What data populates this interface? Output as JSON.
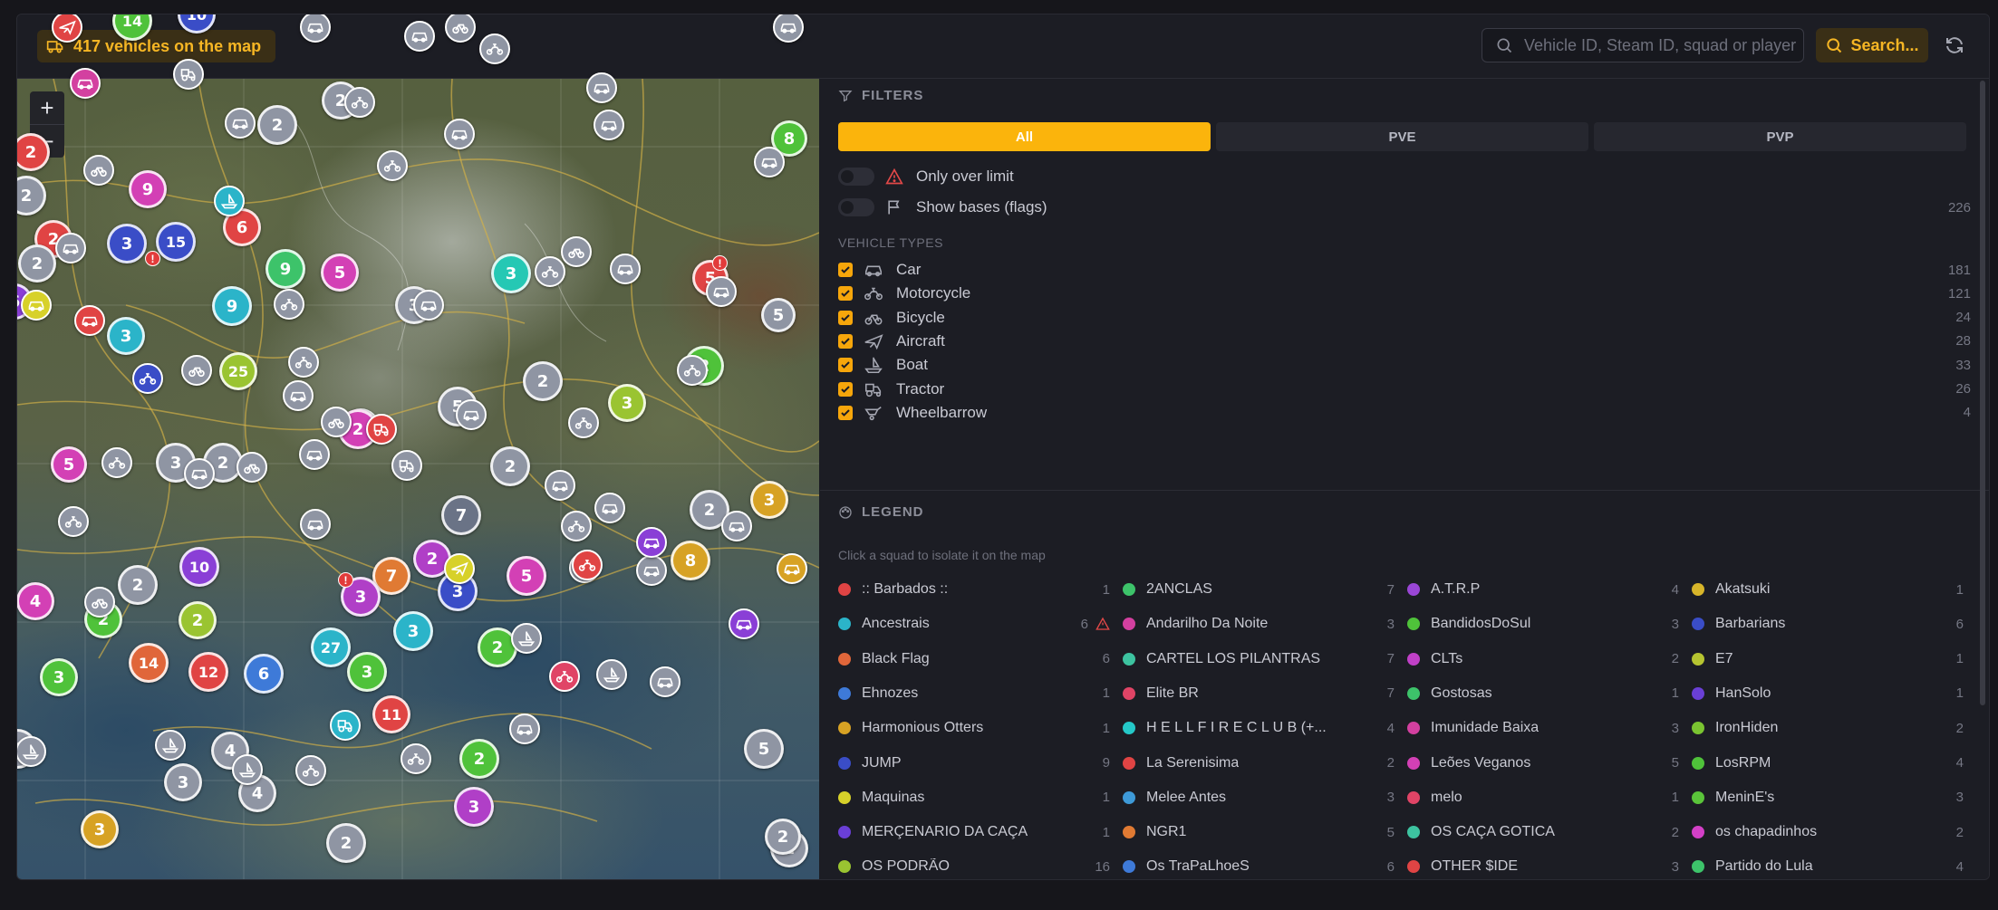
{
  "header": {
    "vehicle_count": "417 vehicles on the map",
    "search_placeholder": "Vehicle ID, Steam ID, squad or player",
    "search_button": "Search..."
  },
  "map": {
    "zoom_in": "+",
    "zoom_out": "−",
    "clusters": [
      {
        "n": "14",
        "c": "#4fc23a"
      },
      {
        "n": "10",
        "c": "#3a4dc7"
      },
      {
        "n": "2",
        "c": "#e04444"
      },
      {
        "n": "2",
        "c": "#8f95a3"
      },
      {
        "n": "2",
        "c": "#e04444"
      },
      {
        "n": "2",
        "c": "#8f95a3"
      },
      {
        "n": "9",
        "c": "#d340b5"
      },
      {
        "n": "3",
        "c": "#3a4dc7"
      },
      {
        "n": "15",
        "c": "#3a4dc7"
      },
      {
        "n": "6",
        "c": "#e04444"
      },
      {
        "n": "2",
        "c": "#8f95a3"
      },
      {
        "n": "2",
        "c": "#8f95a3"
      },
      {
        "n": "6",
        "c": "#8a3fd6"
      },
      {
        "n": "9",
        "c": "#3dc36a"
      },
      {
        "n": "5",
        "c": "#d340b5"
      },
      {
        "n": "9",
        "c": "#2bb4c9"
      },
      {
        "n": "3",
        "c": "#2bb4c9"
      },
      {
        "n": "25",
        "c": "#9ac431"
      },
      {
        "n": "3",
        "c": "#8f95a3"
      },
      {
        "n": "3",
        "c": "#25c8b4"
      },
      {
        "n": "5",
        "c": "#e04444"
      },
      {
        "n": "5",
        "c": "#8f95a3"
      },
      {
        "n": "2",
        "c": "#4fc23a"
      },
      {
        "n": "2",
        "c": "#8f95a3"
      },
      {
        "n": "3",
        "c": "#9ac431"
      },
      {
        "n": "5",
        "c": "#8f95a3"
      },
      {
        "n": "2",
        "c": "#8f95a3"
      },
      {
        "n": "2",
        "c": "#d340b5"
      },
      {
        "n": "2",
        "c": "#8f95a3"
      },
      {
        "n": "3",
        "c": "#8f95a3"
      },
      {
        "n": "5",
        "c": "#d340b5"
      },
      {
        "n": "2",
        "c": "#8f95a3"
      },
      {
        "n": "3",
        "c": "#d7a224"
      },
      {
        "n": "2",
        "c": "#8f95a3"
      },
      {
        "n": "7",
        "c": "#6a7386"
      },
      {
        "n": "10",
        "c": "#8a3fd6"
      },
      {
        "n": "2",
        "c": "#8f95a3"
      },
      {
        "n": "4",
        "c": "#d340b5"
      },
      {
        "n": "2",
        "c": "#4fc23a"
      },
      {
        "n": "2",
        "c": "#9ac431"
      },
      {
        "n": "7",
        "c": "#e07a33"
      },
      {
        "n": "2",
        "c": "#b03fc7"
      },
      {
        "n": "3",
        "c": "#b03fc7"
      },
      {
        "n": "3",
        "c": "#3a4dc7"
      },
      {
        "n": "5",
        "c": "#d340b5"
      },
      {
        "n": "8",
        "c": "#d7a224"
      },
      {
        "n": "14",
        "c": "#e0663a"
      },
      {
        "n": "12",
        "c": "#e04444"
      },
      {
        "n": "6",
        "c": "#3e7ad8"
      },
      {
        "n": "27",
        "c": "#2bb4c9"
      },
      {
        "n": "3",
        "c": "#4fc23a"
      },
      {
        "n": "3",
        "c": "#2bb4c9"
      },
      {
        "n": "2",
        "c": "#4fc23a"
      },
      {
        "n": "3",
        "c": "#4fc23a"
      },
      {
        "n": "11",
        "c": "#e04444"
      },
      {
        "n": "2",
        "c": "#8f95a3"
      },
      {
        "n": "4",
        "c": "#8f95a3"
      },
      {
        "n": "3",
        "c": "#8f95a3"
      },
      {
        "n": "4",
        "c": "#8f95a3"
      },
      {
        "n": "2",
        "c": "#4fc23a"
      },
      {
        "n": "3",
        "c": "#b03fc7"
      },
      {
        "n": "5",
        "c": "#8f95a3"
      },
      {
        "n": "3",
        "c": "#d7a224"
      },
      {
        "n": "2",
        "c": "#8f95a3"
      },
      {
        "n": "2",
        "c": "#8f95a3"
      },
      {
        "n": "2",
        "c": "#8f95a3"
      },
      {
        "n": "8",
        "c": "#4fc23a"
      }
    ]
  },
  "filters": {
    "title": "FILTERS",
    "tabs": [
      "All",
      "PVE",
      "PVP"
    ],
    "only_over_limit": "Only over limit",
    "show_bases": "Show bases (flags)",
    "bases_count": "226",
    "vehicle_types_heading": "VEHICLE TYPES",
    "vehicle_types": [
      {
        "label": "Car",
        "count": "181",
        "icon": "car-icon"
      },
      {
        "label": "Motorcycle",
        "count": "121",
        "icon": "motorcycle-icon"
      },
      {
        "label": "Bicycle",
        "count": "24",
        "icon": "bicycle-icon"
      },
      {
        "label": "Aircraft",
        "count": "28",
        "icon": "aircraft-icon"
      },
      {
        "label": "Boat",
        "count": "33",
        "icon": "boat-icon"
      },
      {
        "label": "Tractor",
        "count": "26",
        "icon": "tractor-icon"
      },
      {
        "label": "Wheelbarrow",
        "count": "4",
        "icon": "wheelbarrow-icon"
      }
    ]
  },
  "legend": {
    "title": "LEGEND",
    "hint": "Click a squad to isolate it on the map",
    "squads": [
      {
        "name": ":: Barbados ::",
        "count": "1",
        "color": "#e04444"
      },
      {
        "name": "2ANCLAS",
        "count": "7",
        "color": "#3dc36a"
      },
      {
        "name": "A.T.R.P",
        "count": "4",
        "color": "#9a46d6"
      },
      {
        "name": "Akatsuki",
        "count": "1",
        "color": "#d7b52a"
      },
      {
        "name": "Ancestrais",
        "count": "6",
        "color": "#2bb4c9",
        "warning": true
      },
      {
        "name": "Andarilho Da Noite",
        "count": "3",
        "color": "#d340a0"
      },
      {
        "name": "BandidosDoSul",
        "count": "3",
        "color": "#4fc23a"
      },
      {
        "name": "Barbarians",
        "count": "6",
        "color": "#3a4dc7"
      },
      {
        "name": "Black Flag",
        "count": "6",
        "color": "#e0663a"
      },
      {
        "name": "CARTEL LOS PILANTRAS",
        "count": "7",
        "color": "#3dc3a0"
      },
      {
        "name": "CLTs",
        "count": "2",
        "color": "#c040c7"
      },
      {
        "name": "E7",
        "count": "1",
        "color": "#b6c431"
      },
      {
        "name": "Ehnozes",
        "count": "1",
        "color": "#3e7ad8"
      },
      {
        "name": "Elite BR",
        "count": "7",
        "color": "#e04466"
      },
      {
        "name": "Gostosas",
        "count": "1",
        "color": "#3dc36a"
      },
      {
        "name": "HanSolo",
        "count": "1",
        "color": "#6a3fd6"
      },
      {
        "name": "Harmonious Otters",
        "count": "1",
        "color": "#d7a224"
      },
      {
        "name": "H E L L F I R E   C L U B (+...",
        "count": "4",
        "color": "#25c8c8"
      },
      {
        "name": "Imunidade Baixa",
        "count": "3",
        "color": "#d340a0"
      },
      {
        "name": "IronHiden",
        "count": "2",
        "color": "#7ac431"
      },
      {
        "name": "JUMP",
        "count": "9",
        "color": "#3a4dc7"
      },
      {
        "name": "La Serenisima",
        "count": "2",
        "color": "#e04444"
      },
      {
        "name": "Leões Veganos",
        "count": "5",
        "color": "#d340b5"
      },
      {
        "name": "LosRPM",
        "count": "4",
        "color": "#4fc23a"
      },
      {
        "name": "Maquinas",
        "count": "1",
        "color": "#d7d12a"
      },
      {
        "name": "Melee Antes",
        "count": "3",
        "color": "#3e9ad8"
      },
      {
        "name": "melo",
        "count": "1",
        "color": "#e04466"
      },
      {
        "name": "MeninE's",
        "count": "3",
        "color": "#5ac43a"
      },
      {
        "name": "MERÇENARIO DA CAÇA",
        "count": "1",
        "color": "#6a3fd6"
      },
      {
        "name": "NGR1",
        "count": "5",
        "color": "#e07a33"
      },
      {
        "name": "OS CAÇA GOTICA",
        "count": "2",
        "color": "#3dc3a0"
      },
      {
        "name": "os chapadinhos",
        "count": "2",
        "color": "#d340c7"
      },
      {
        "name": "OS PODRÃO",
        "count": "16",
        "color": "#9ac431"
      },
      {
        "name": "Os TraPaLhoeS",
        "count": "6",
        "color": "#3e7ad8"
      },
      {
        "name": "OTHER $IDE",
        "count": "3",
        "color": "#e04444"
      },
      {
        "name": "Partido do Lula",
        "count": "4",
        "color": "#3dc36a"
      }
    ]
  }
}
